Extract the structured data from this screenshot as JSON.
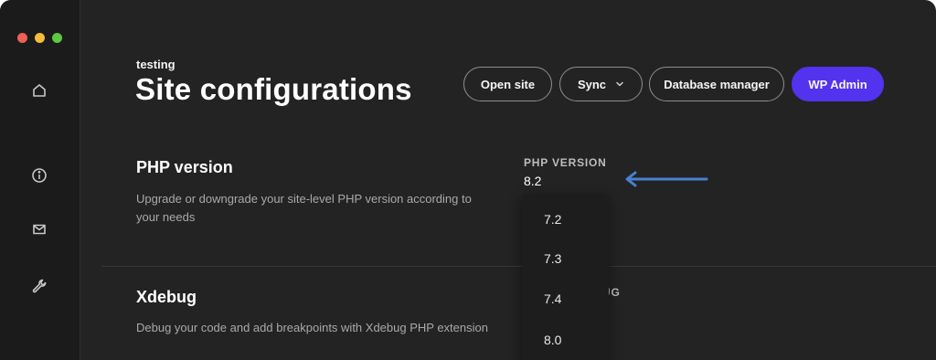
{
  "window": {
    "traffic_lights": [
      "close",
      "minimize",
      "zoom"
    ]
  },
  "sidebar": {
    "items": [
      {
        "icon": "home-icon"
      },
      {
        "icon": "info-icon"
      },
      {
        "icon": "mail-icon"
      },
      {
        "icon": "wrench-icon"
      }
    ]
  },
  "header": {
    "site_name": "testing",
    "title": "Site configurations",
    "buttons": {
      "open_site": "Open site",
      "sync": "Sync",
      "database_manager": "Database manager",
      "wp_admin": "WP Admin"
    }
  },
  "php_section": {
    "title": "PHP version",
    "description": "Upgrade or downgrade your site-level PHP version according to your needs",
    "field_label": "PHP VERSION",
    "current_value": "8.2",
    "dropdown_options": [
      "7.2",
      "7.3",
      "7.4",
      "8.0"
    ]
  },
  "xdebug_section": {
    "title": "Xdebug",
    "description": "Debug your code and add breakpoints with Xdebug PHP extension",
    "field_label_visible": "UG"
  },
  "colors": {
    "background": "#232323",
    "sidebar": "#1b1b1b",
    "accent": "#5333ed",
    "annotation_arrow": "#4a7fd4"
  }
}
